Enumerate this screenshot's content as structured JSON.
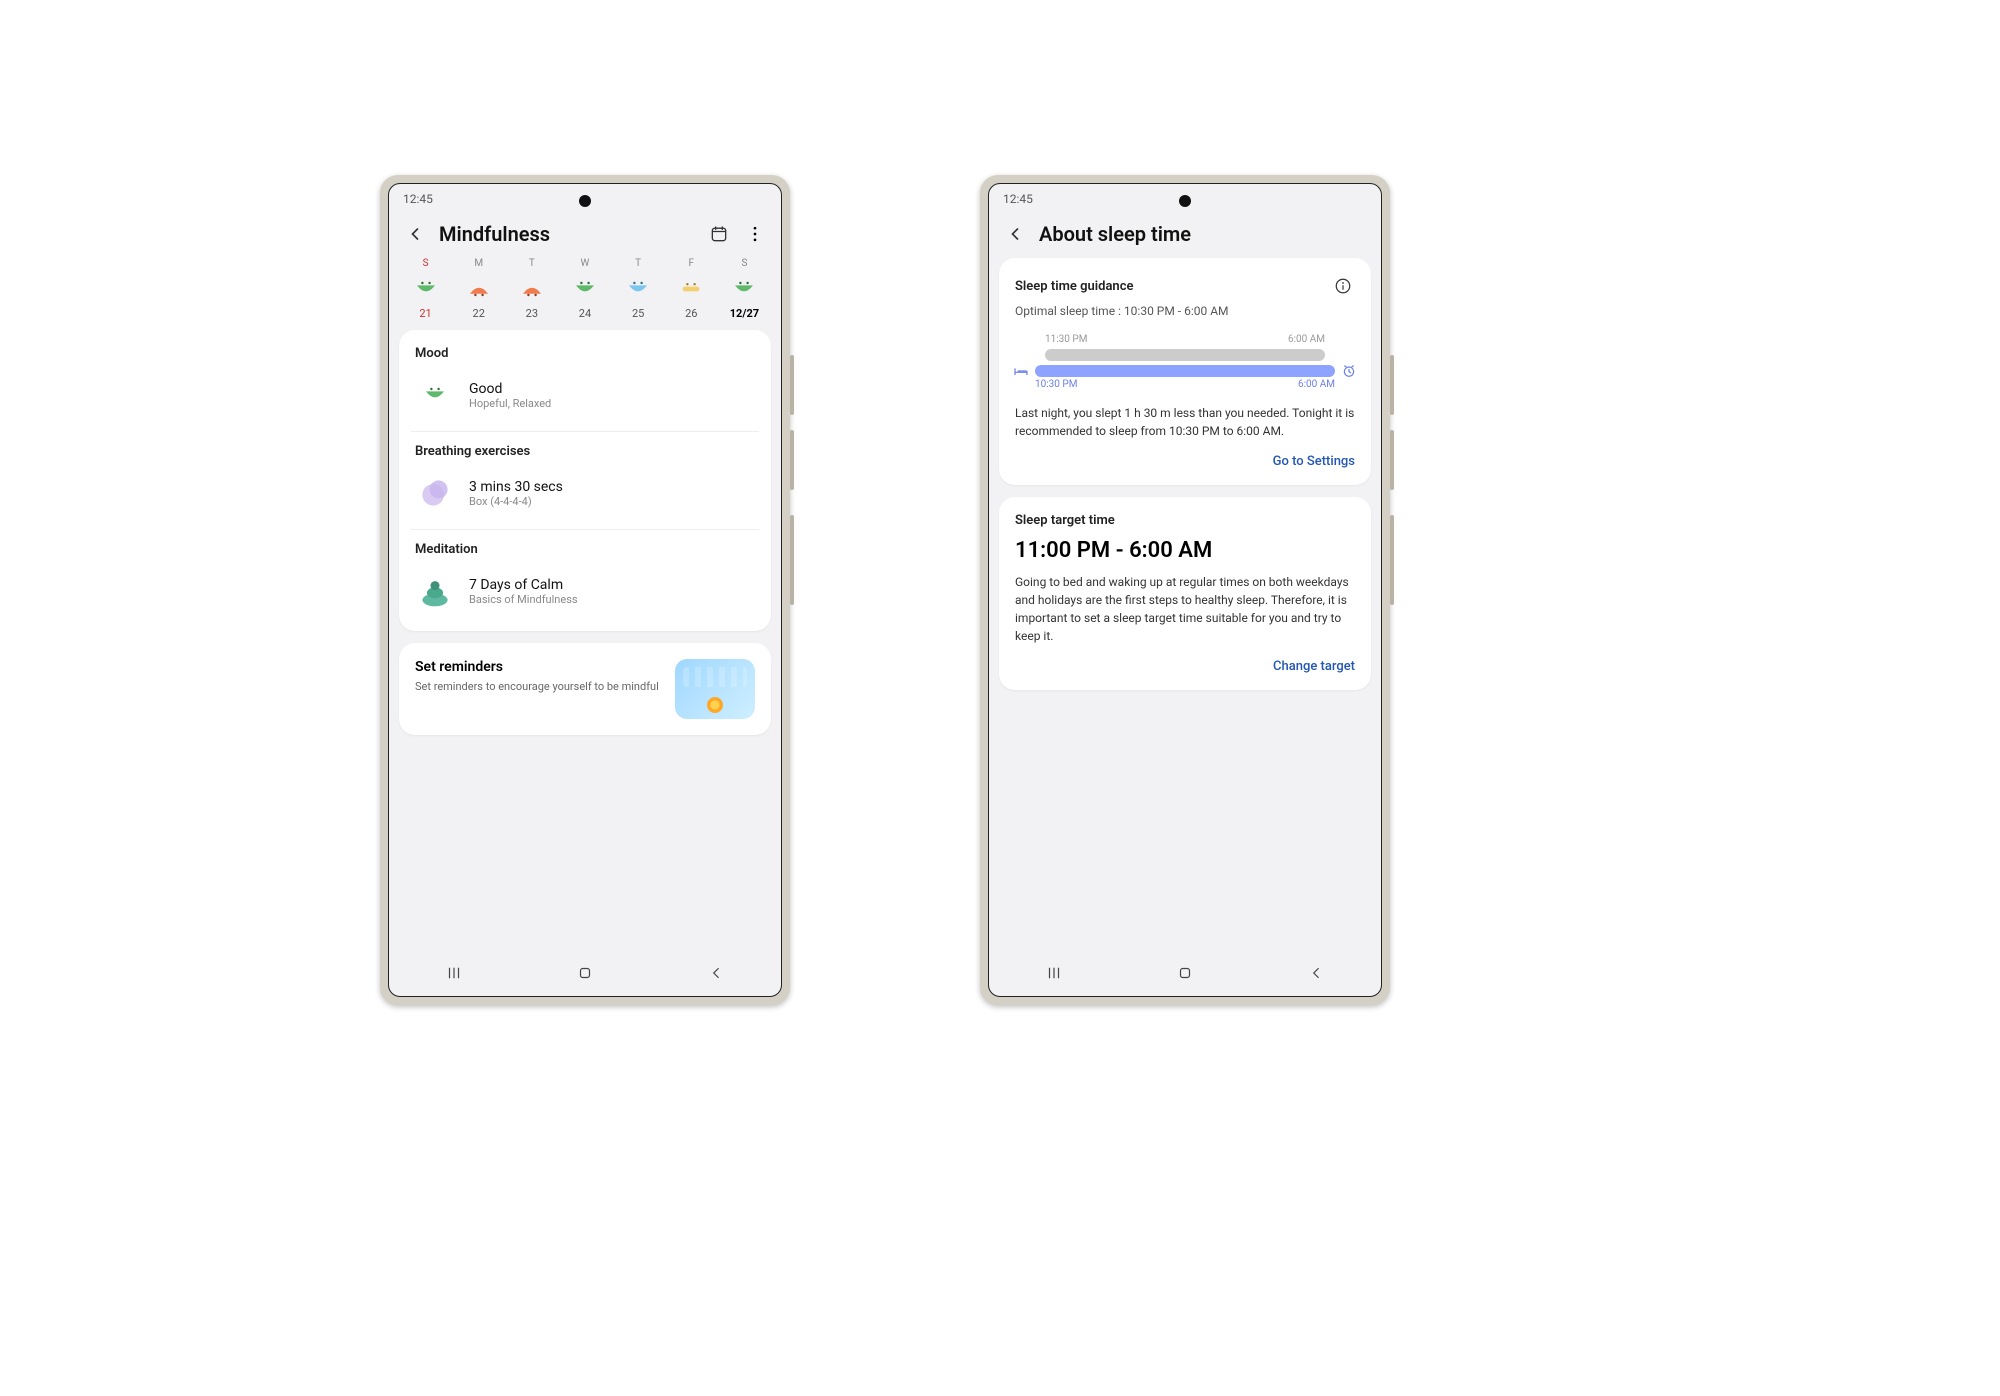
{
  "status_time": "12:45",
  "mindfulness": {
    "title": "Mindfulness",
    "days": [
      {
        "letter": "S",
        "num": "21",
        "mood": "happy-green",
        "sun": true
      },
      {
        "letter": "M",
        "num": "22",
        "mood": "sad-orange"
      },
      {
        "letter": "T",
        "num": "23",
        "mood": "sad-orange"
      },
      {
        "letter": "W",
        "num": "24",
        "mood": "happy-green"
      },
      {
        "letter": "T",
        "num": "25",
        "mood": "happy-blue"
      },
      {
        "letter": "F",
        "num": "26",
        "mood": "neutral-yellow"
      },
      {
        "letter": "S",
        "num": "12/27",
        "mood": "happy-green",
        "selected": true
      }
    ],
    "mood": {
      "section": "Mood",
      "value": "Good",
      "tags": "Hopeful, Relaxed"
    },
    "breathing": {
      "section": "Breathing exercises",
      "value": "3 mins 30 secs",
      "sub": "Box (4-4-4-4)"
    },
    "meditation": {
      "section": "Meditation",
      "value": "7 Days of Calm",
      "sub": "Basics of Mindfulness"
    },
    "reminders": {
      "title": "Set reminders",
      "desc": "Set reminders to encourage yourself to be mindful"
    }
  },
  "sleep": {
    "title": "About sleep time",
    "guidance": {
      "section": "Sleep time guidance",
      "optimal": "Optimal sleep time : 10:30 PM - 6:00 AM",
      "actual_start": "11:30 PM",
      "actual_end": "6:00 AM",
      "target_start": "10:30 PM",
      "target_end": "6:00 AM",
      "para": "Last night, you slept 1 h 30 m less than you needed. Tonight it is recommended to sleep from 10:30 PM to 6:00 AM.",
      "settings_link": "Go to Settings"
    },
    "target": {
      "section": "Sleep target time",
      "value": "11:00 PM - 6:00 AM",
      "para": "Going to bed and waking up at regular times on both weekdays and holidays are the first steps to healthy sleep. Therefore, it is important to set a sleep target time suitable for you and try to keep it.",
      "change_link": "Change target"
    }
  }
}
